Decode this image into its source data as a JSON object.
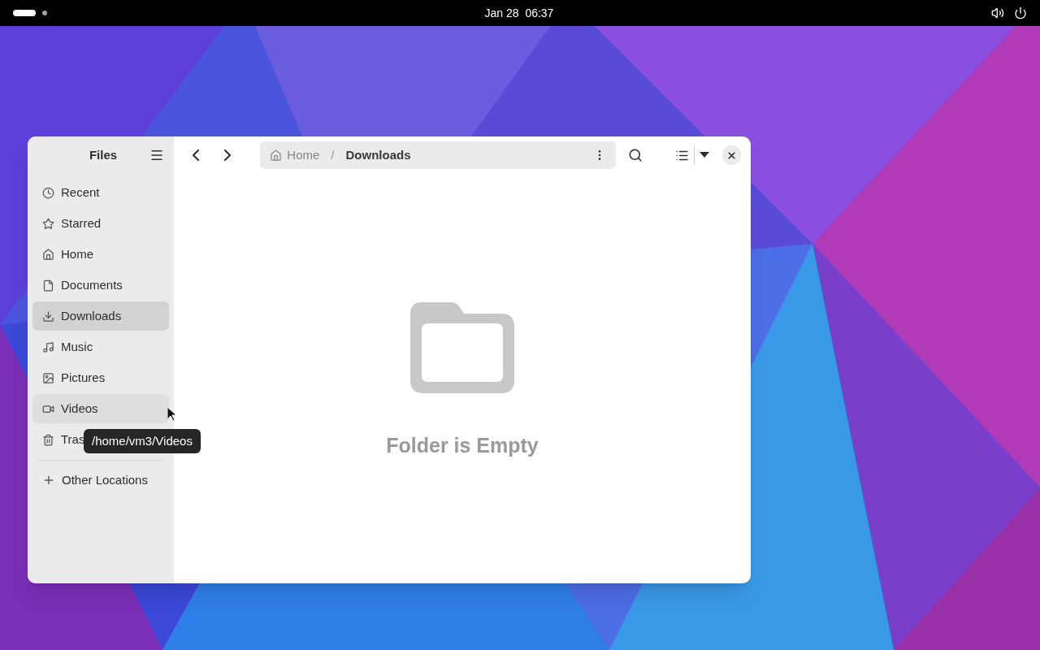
{
  "top_bar": {
    "clock": "Jan 28  06:37"
  },
  "window": {
    "sidebar": {
      "title": "Files",
      "items": [
        {
          "kind": "recent",
          "label": "Recent",
          "selected": false,
          "hovered": false
        },
        {
          "kind": "starred",
          "label": "Starred",
          "selected": false,
          "hovered": false
        },
        {
          "kind": "home",
          "label": "Home",
          "selected": false,
          "hovered": false
        },
        {
          "kind": "documents",
          "label": "Documents",
          "selected": false,
          "hovered": false
        },
        {
          "kind": "downloads",
          "label": "Downloads",
          "selected": true,
          "hovered": false
        },
        {
          "kind": "music",
          "label": "Music",
          "selected": false,
          "hovered": false
        },
        {
          "kind": "pictures",
          "label": "Pictures",
          "selected": false,
          "hovered": false
        },
        {
          "kind": "videos",
          "label": "Videos",
          "selected": false,
          "hovered": true
        },
        {
          "kind": "trash",
          "label": "Tras",
          "selected": false,
          "hovered": false
        }
      ],
      "other_locations": "Other Locations"
    },
    "path_bar": {
      "segments": [
        "Home",
        "Downloads"
      ],
      "separator": "/"
    },
    "empty_state": "Folder is Empty"
  },
  "tooltip": "/home/vm3/Videos"
}
